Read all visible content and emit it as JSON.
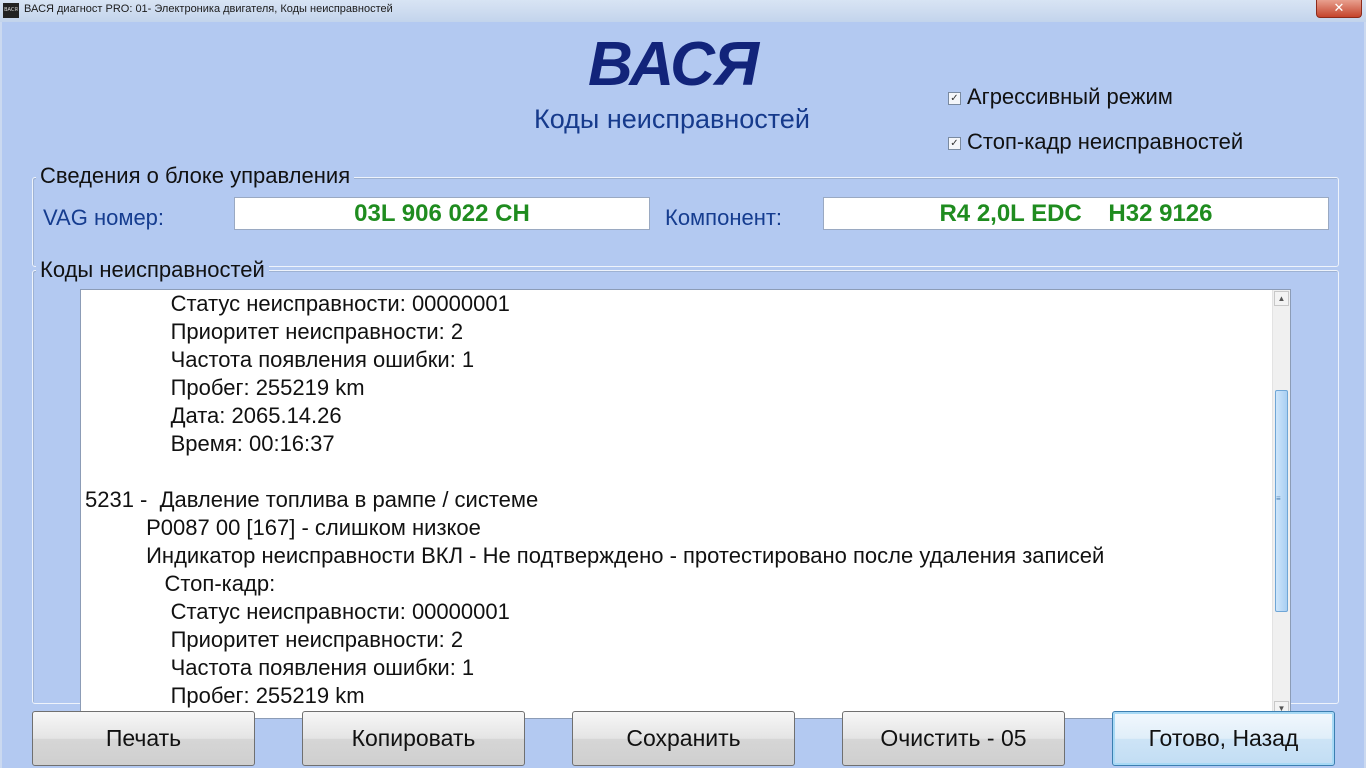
{
  "window": {
    "title": "ВАСЯ диагност PRO: 01- Электроника двигателя,  Коды неисправностей",
    "app_icon_label": "ВАСЯ",
    "close_label": "✕"
  },
  "header": {
    "logo": "ВАСЯ",
    "subtitle": "Коды неисправностей"
  },
  "options": {
    "aggressive_mode": {
      "label": "Агрессивный режим",
      "checked": true
    },
    "freeze_frame": {
      "label": "Стоп-кадр неисправностей",
      "checked": true
    },
    "check_glyph": "☑"
  },
  "control_unit": {
    "group_title": "Сведения о блоке управления",
    "vag_label": "VAG номер:",
    "vag_value": "03L 906 022 CH",
    "component_label": "Компонент:",
    "component_value": "R4 2,0L EDC    H32 9126"
  },
  "fault_codes": {
    "group_title": "Коды неисправностей",
    "lines": [
      "              Статус неисправности: 00000001",
      "              Приоритет неисправности: 2",
      "              Частота появления ошибки: 1",
      "              Пробег: 255219 km",
      "              Дата: 2065.14.26",
      "              Время: 00:16:37",
      "",
      "5231 -  Давление топлива в рампе / системе",
      "          P0087 00 [167] - слишком низкое",
      "          Индикатор неисправности ВКЛ - Не подтверждено - протестировано после удаления записей",
      "             Стоп-кадр:",
      "              Статус неисправности: 00000001",
      "              Приоритет неисправности: 2",
      "              Частота появления ошибки: 1",
      "              Пробег: 255219 km"
    ],
    "scroll_up_glyph": "▲",
    "scroll_down_glyph": "▼",
    "grip_glyph": "≡"
  },
  "buttons": {
    "print": "Печать",
    "copy": "Копировать",
    "save": "Сохранить",
    "clear": "Очистить - 05",
    "done": "Готово, Назад"
  }
}
